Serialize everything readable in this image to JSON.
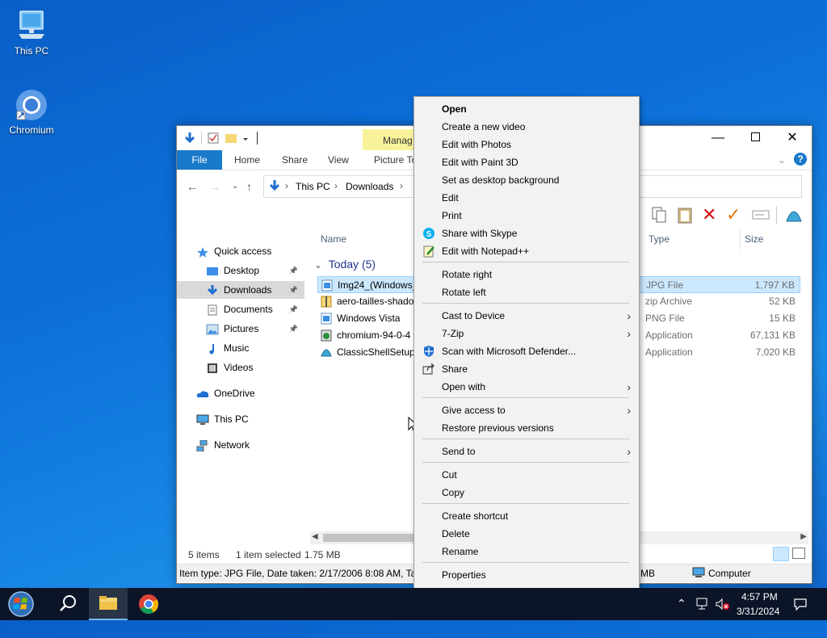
{
  "desktop": {
    "icons": [
      {
        "label": "This PC",
        "icon": "monitor-icon"
      },
      {
        "label": "Chromium",
        "icon": "chromium-icon"
      }
    ]
  },
  "explorer": {
    "ribbon_tabs": [
      "File",
      "Home",
      "Share",
      "View",
      "Picture To"
    ],
    "manage_label": "Manag",
    "breadcrumb": [
      "This PC",
      "Downloads"
    ],
    "nav": [
      {
        "label": "Quick access",
        "icon": "star-icon"
      },
      {
        "label": "Desktop",
        "icon": "desktop-folder-icon",
        "pinned": true
      },
      {
        "label": "Downloads",
        "icon": "downloads-icon",
        "pinned": true,
        "selected": true
      },
      {
        "label": "Documents",
        "icon": "documents-icon",
        "pinned": true
      },
      {
        "label": "Pictures",
        "icon": "pictures-icon",
        "pinned": true
      },
      {
        "label": "Music",
        "icon": "music-icon"
      },
      {
        "label": "Videos",
        "icon": "videos-icon"
      },
      {
        "label": "OneDrive",
        "icon": "onedrive-icon"
      },
      {
        "label": "This PC",
        "icon": "monitor-icon"
      },
      {
        "label": "Network",
        "icon": "network-icon"
      }
    ],
    "columns": {
      "name": "Name",
      "type": "Type",
      "size": "Size"
    },
    "group": "Today (5)",
    "files": [
      {
        "name": "Img24_(Windows_",
        "type": "JPG File",
        "size": "1,797 KB",
        "selected": true
      },
      {
        "name": "aero-tailles-shado",
        "type": "zip Archive",
        "size": "52 KB"
      },
      {
        "name": "Windows Vista",
        "type": "PNG File",
        "size": "15 KB"
      },
      {
        "name": "chromium-94-0-4",
        "type": "Application",
        "size": "67,131 KB"
      },
      {
        "name": "ClassicShellSetup_",
        "type": "Application",
        "size": "7,020 KB"
      }
    ],
    "status": {
      "items": "5 items",
      "selected": "1 item selected",
      "size": "1.75 MB"
    },
    "details": {
      "text": "Item type: JPG File, Date taken: 2/17/2006 8:08 AM, Tags",
      "size": "MB",
      "location": "Computer"
    }
  },
  "context_menu": {
    "items": [
      {
        "label": "Open",
        "bold": true
      },
      {
        "label": "Create a new video"
      },
      {
        "label": "Edit with Photos"
      },
      {
        "label": "Edit with Paint 3D"
      },
      {
        "label": "Set as desktop background"
      },
      {
        "label": "Edit"
      },
      {
        "label": "Print"
      },
      {
        "label": "Share with Skype",
        "icon": "skype-icon"
      },
      {
        "label": "Edit with Notepad++",
        "icon": "notepadpp-icon"
      },
      {
        "sep": true
      },
      {
        "label": "Rotate right"
      },
      {
        "label": "Rotate left"
      },
      {
        "sep": true
      },
      {
        "label": "Cast to Device",
        "submenu": true
      },
      {
        "label": "7-Zip",
        "submenu": true
      },
      {
        "label": "Scan with Microsoft Defender...",
        "icon": "defender-icon"
      },
      {
        "label": "Share",
        "icon": "share-icon"
      },
      {
        "label": "Open with",
        "submenu": true
      },
      {
        "sep": true
      },
      {
        "label": "Give access to",
        "submenu": true
      },
      {
        "label": "Restore previous versions"
      },
      {
        "sep": true
      },
      {
        "label": "Send to",
        "submenu": true
      },
      {
        "sep": true
      },
      {
        "label": "Cut"
      },
      {
        "label": "Copy"
      },
      {
        "sep": true
      },
      {
        "label": "Create shortcut"
      },
      {
        "label": "Delete"
      },
      {
        "label": "Rename"
      },
      {
        "sep": true
      },
      {
        "label": "Properties"
      }
    ]
  },
  "taskbar": {
    "clock_time": "4:57 PM",
    "clock_date": "3/31/2024"
  },
  "colors": {
    "accent": "#1979ca",
    "taskbar": "#0c1427",
    "selection": "#cce8ff"
  }
}
